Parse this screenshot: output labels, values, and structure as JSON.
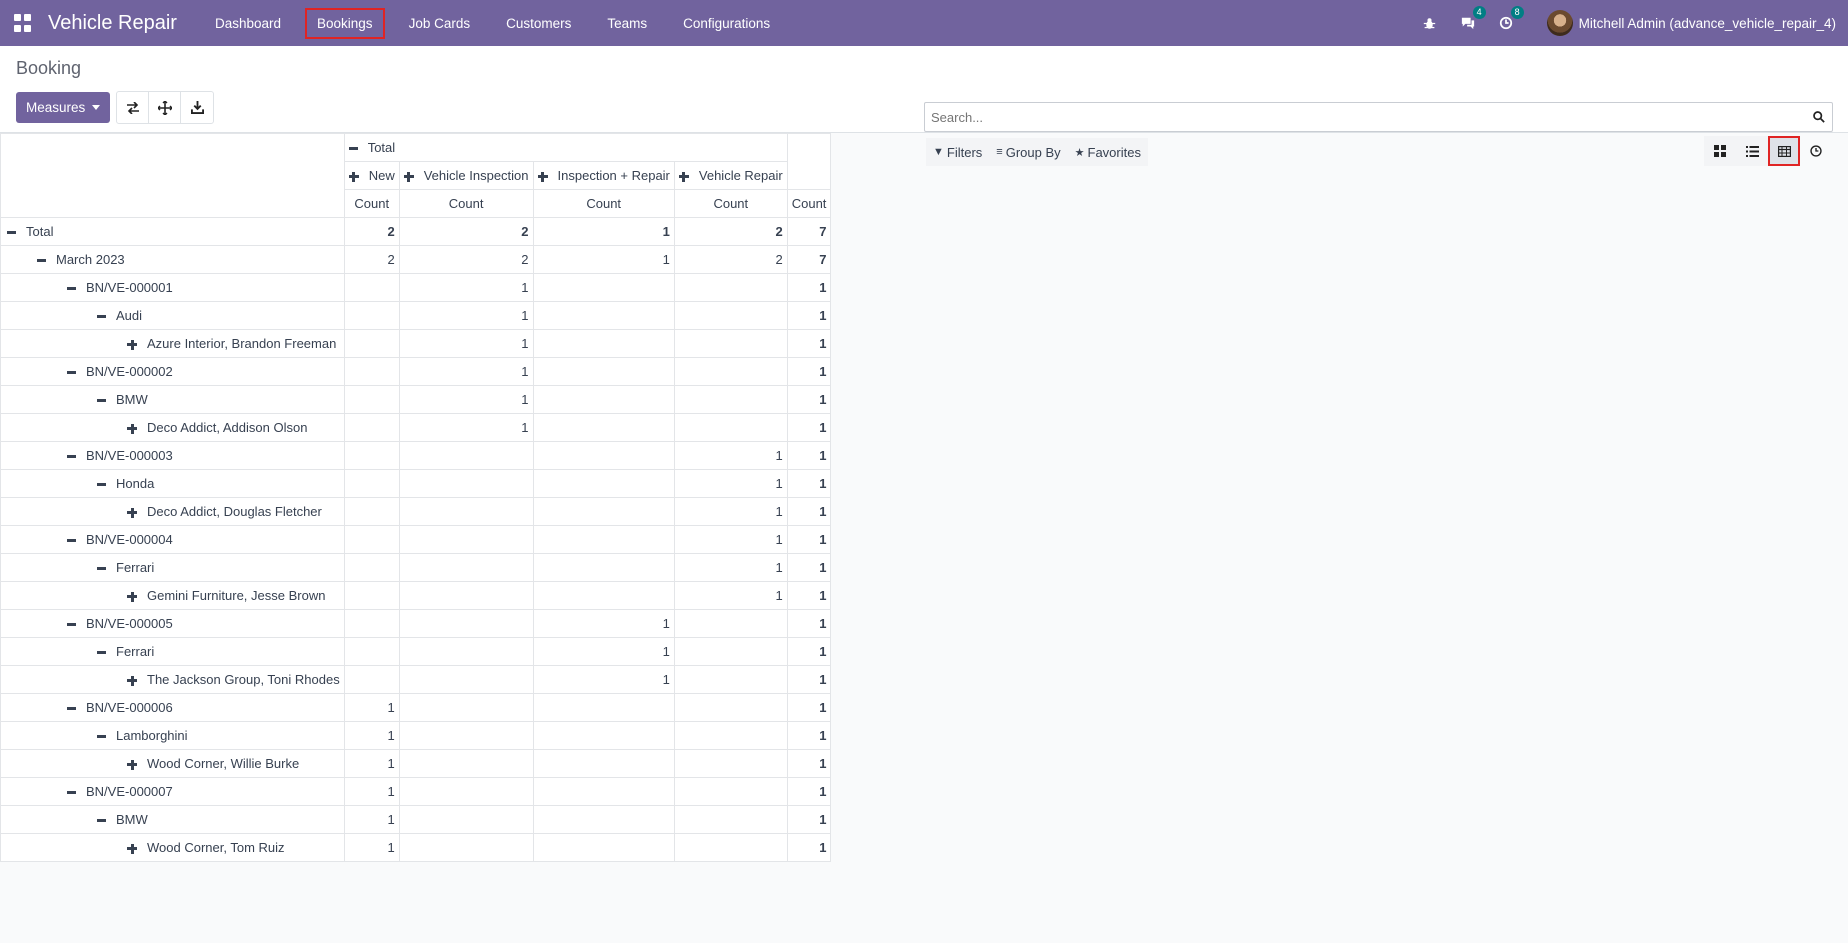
{
  "app": {
    "title": "Vehicle Repair"
  },
  "nav": {
    "items": [
      "Dashboard",
      "Bookings",
      "Job Cards",
      "Customers",
      "Teams",
      "Configurations"
    ],
    "active": "Bookings"
  },
  "systray": {
    "messages_badge": "4",
    "activities_badge": "8",
    "user": "Mitchell Admin (advance_vehicle_repair_4)"
  },
  "control_panel": {
    "breadcrumb": "Booking",
    "measures_label": "Measures",
    "search_placeholder": "Search...",
    "filters_label": "Filters",
    "groupby_label": "Group By",
    "favorites_label": "Favorites"
  },
  "pivot": {
    "col_total_label": "Total",
    "col_groups": [
      "New",
      "Vehicle Inspection",
      "Inspection + Repair",
      "Vehicle Repair"
    ],
    "measure_label": "Count",
    "rows": [
      {
        "level": 0,
        "label": "Total",
        "expanded": true,
        "cells": [
          "2",
          "2",
          "1",
          "2"
        ],
        "total": "7",
        "bold": true
      },
      {
        "level": 1,
        "label": "March 2023",
        "expanded": true,
        "cells": [
          "2",
          "2",
          "1",
          "2"
        ],
        "total": "7"
      },
      {
        "level": 2,
        "label": "BN/VE-000001",
        "expanded": true,
        "cells": [
          "",
          "1",
          "",
          ""
        ],
        "total": "1"
      },
      {
        "level": 3,
        "label": "Audi",
        "expanded": true,
        "cells": [
          "",
          "1",
          "",
          ""
        ],
        "total": "1"
      },
      {
        "level": 4,
        "label": "Azure Interior, Brandon Freeman",
        "expanded": false,
        "cells": [
          "",
          "1",
          "",
          ""
        ],
        "total": "1"
      },
      {
        "level": 2,
        "label": "BN/VE-000002",
        "expanded": true,
        "cells": [
          "",
          "1",
          "",
          ""
        ],
        "total": "1"
      },
      {
        "level": 3,
        "label": "BMW",
        "expanded": true,
        "cells": [
          "",
          "1",
          "",
          ""
        ],
        "total": "1"
      },
      {
        "level": 4,
        "label": "Deco Addict, Addison Olson",
        "expanded": false,
        "cells": [
          "",
          "1",
          "",
          ""
        ],
        "total": "1"
      },
      {
        "level": 2,
        "label": "BN/VE-000003",
        "expanded": true,
        "cells": [
          "",
          "",
          "",
          "1"
        ],
        "total": "1"
      },
      {
        "level": 3,
        "label": "Honda",
        "expanded": true,
        "cells": [
          "",
          "",
          "",
          "1"
        ],
        "total": "1"
      },
      {
        "level": 4,
        "label": "Deco Addict, Douglas Fletcher",
        "expanded": false,
        "cells": [
          "",
          "",
          "",
          "1"
        ],
        "total": "1"
      },
      {
        "level": 2,
        "label": "BN/VE-000004",
        "expanded": true,
        "cells": [
          "",
          "",
          "",
          "1"
        ],
        "total": "1"
      },
      {
        "level": 3,
        "label": "Ferrari",
        "expanded": true,
        "cells": [
          "",
          "",
          "",
          "1"
        ],
        "total": "1"
      },
      {
        "level": 4,
        "label": "Gemini Furniture, Jesse Brown",
        "expanded": false,
        "cells": [
          "",
          "",
          "",
          "1"
        ],
        "total": "1"
      },
      {
        "level": 2,
        "label": "BN/VE-000005",
        "expanded": true,
        "cells": [
          "",
          "",
          "1",
          ""
        ],
        "total": "1"
      },
      {
        "level": 3,
        "label": "Ferrari",
        "expanded": true,
        "cells": [
          "",
          "",
          "1",
          ""
        ],
        "total": "1"
      },
      {
        "level": 4,
        "label": "The Jackson Group, Toni Rhodes",
        "expanded": false,
        "cells": [
          "",
          "",
          "1",
          ""
        ],
        "total": "1"
      },
      {
        "level": 2,
        "label": "BN/VE-000006",
        "expanded": true,
        "cells": [
          "1",
          "",
          "",
          ""
        ],
        "total": "1"
      },
      {
        "level": 3,
        "label": "Lamborghini",
        "expanded": true,
        "cells": [
          "1",
          "",
          "",
          ""
        ],
        "total": "1"
      },
      {
        "level": 4,
        "label": "Wood Corner, Willie Burke",
        "expanded": false,
        "cells": [
          "1",
          "",
          "",
          ""
        ],
        "total": "1"
      },
      {
        "level": 2,
        "label": "BN/VE-000007",
        "expanded": true,
        "cells": [
          "1",
          "",
          "",
          ""
        ],
        "total": "1"
      },
      {
        "level": 3,
        "label": "BMW",
        "expanded": true,
        "cells": [
          "1",
          "",
          "",
          ""
        ],
        "total": "1"
      },
      {
        "level": 4,
        "label": "Wood Corner, Tom Ruiz",
        "expanded": false,
        "cells": [
          "1",
          "",
          "",
          ""
        ],
        "total": "1"
      }
    ]
  },
  "colors": {
    "brand": "#71639e",
    "highlight": "#e02424",
    "badge": "#017e84"
  }
}
